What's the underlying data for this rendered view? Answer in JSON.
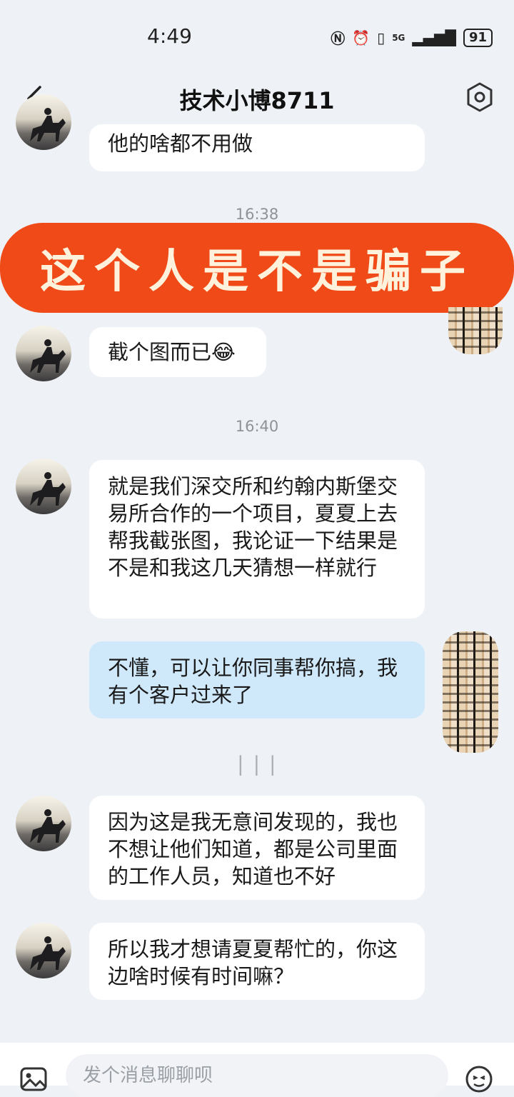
{
  "status": {
    "time": "4:49",
    "network": "5G",
    "battery": "91"
  },
  "header": {
    "title": "技术小博8711"
  },
  "banner": {
    "text": "这个人是不是骗子"
  },
  "timestamps": {
    "t1": "16:38",
    "t2": "16:40"
  },
  "messages": [
    {
      "side": "in",
      "text": "他的啥都不用做"
    },
    {
      "side": "in",
      "text": "截个图而已😂"
    },
    {
      "side": "in",
      "text": "就是我们深交所和约翰内斯堡交易所合作的一个项目，夏夏上去帮我截张图，我论证一下结果是不是和我这几天猜想一样就行"
    },
    {
      "side": "out",
      "text": "不懂，可以让你同事帮你搞，我有个客户过来了"
    },
    {
      "side": "in",
      "text": "因为这是我无意间发现的，我也不想让他们知道，都是公司里面的工作人员，知道也不好"
    },
    {
      "side": "in",
      "text": "所以我才想请夏夏帮忙的，你这边啥时候有时间嘛？"
    }
  ],
  "input": {
    "placeholder": "发个消息聊聊呗"
  },
  "colors": {
    "banner": "#f04a18",
    "outgoing_bubble": "#cfe8fa",
    "background": "#eef1f5"
  }
}
